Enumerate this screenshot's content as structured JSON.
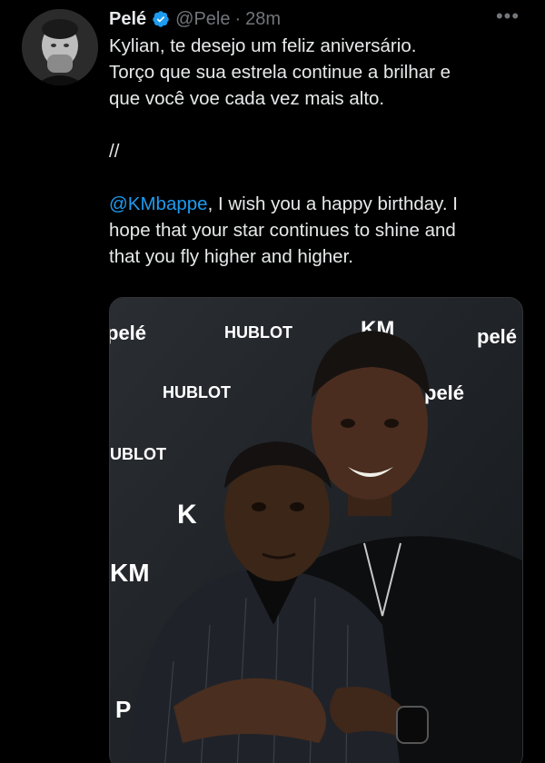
{
  "tweet": {
    "author_name": "Pelé",
    "handle": "@Pele",
    "separator": "·",
    "time": "28m",
    "more_label": "•••",
    "text_pt": "Kylian, te desejo um feliz aniversário.\nTorço que sua estrela continue a brilhar e\nque você voe cada vez mais alto.",
    "divider": "//",
    "mention": "@KMbappe",
    "text_en": ", I wish you a happy birthday. I\nhope that your star continues to shine and\nthat you fly higher and higher."
  },
  "media": {
    "backdrop_texts": {
      "pele_1": "pelé",
      "pele_2": "pelé",
      "pele_3": "pelé",
      "hublot_1": "HUBLOT",
      "hublot_2": "HUBLOT",
      "hublot_3": "UBLOT",
      "km_1": "KM",
      "km_2": "K",
      "km_3": "KM",
      "p_partial": "P"
    }
  },
  "colors": {
    "background": "#000000",
    "text": "#e7e9ea",
    "muted": "#71767b",
    "link": "#1d9bf0",
    "verified": "#1d9bf0"
  },
  "icons": {
    "verified": "verified-badge-icon",
    "more": "more-dots-icon"
  }
}
